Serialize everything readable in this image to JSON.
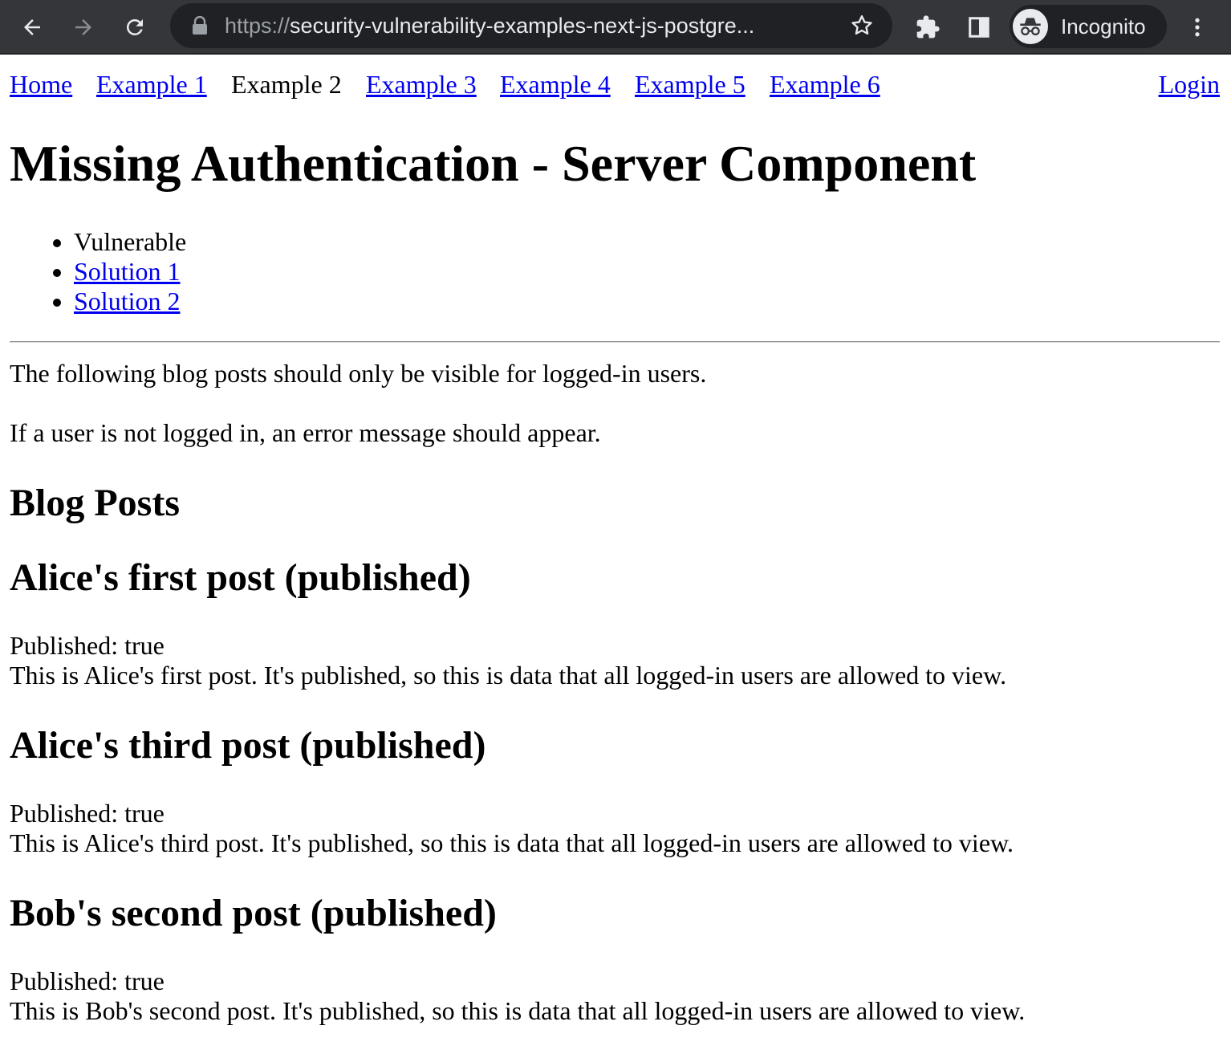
{
  "browser": {
    "url_scheme": "https://",
    "url_rest": "security-vulnerability-examples-next-js-postgre...",
    "profile_label": "Incognito"
  },
  "nav": {
    "home": "Home",
    "example1": "Example 1",
    "example2": "Example 2",
    "example3": "Example 3",
    "example4": "Example 4",
    "example5": "Example 5",
    "example6": "Example 6",
    "login": "Login"
  },
  "page": {
    "title": "Missing Authentication - Server Component",
    "sub_nav": [
      "Vulnerable",
      "Solution 1",
      "Solution 2"
    ],
    "info1": "The following blog posts should only be visible for logged-in users.",
    "info2": "If a user is not logged in, an error message should appear.",
    "section_title": "Blog Posts"
  },
  "posts": [
    {
      "title": "Alice's first post (published)",
      "status": "Published: true",
      "body": "This is Alice's first post. It's published, so this is data that all logged-in users are allowed to view."
    },
    {
      "title": "Alice's third post (published)",
      "status": "Published: true",
      "body": "This is Alice's third post. It's published, so this is data that all logged-in users are allowed to view."
    },
    {
      "title": "Bob's second post (published)",
      "status": "Published: true",
      "body": "This is Bob's second post. It's published, so this is data that all logged-in users are allowed to view."
    }
  ]
}
